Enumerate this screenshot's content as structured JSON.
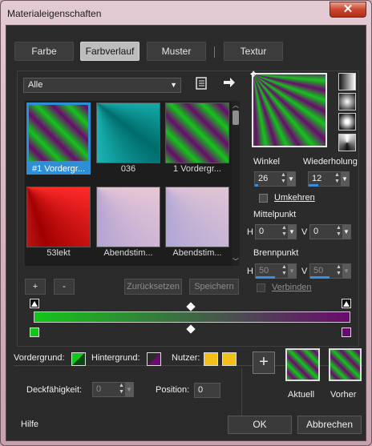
{
  "window": {
    "title": "Materialeigenschaften",
    "close_glyph": "✕"
  },
  "tabs": [
    {
      "label": "Farbe",
      "active": false
    },
    {
      "label": "Farbverlauf",
      "active": true
    },
    {
      "label": "Muster",
      "active": false
    },
    {
      "label": "Textur",
      "active": false
    }
  ],
  "library": {
    "category": "Alle",
    "items": [
      {
        "label": "#1 Vordergr...",
        "style": "fg",
        "selected": true
      },
      {
        "label": "036",
        "style": "cyan",
        "selected": false
      },
      {
        "label": "1 Vordergr...",
        "style": "fg2",
        "selected": false
      },
      {
        "label": "53lekt",
        "style": "red",
        "selected": false
      },
      {
        "label": "Abendstim...",
        "style": "dusk",
        "selected": false
      },
      {
        "label": "Abendstim...",
        "style": "dusk2",
        "selected": false
      }
    ],
    "add_label": "+",
    "remove_label": "-",
    "reset_label": "Zurücksetzen",
    "save_label": "Speichern"
  },
  "settings": {
    "angle_label": "Winkel",
    "angle_value": "26",
    "repeat_label": "Wiederholung",
    "repeat_value": "12",
    "invert_label": "Umkehren",
    "midpoint_label": "Mittelpunkt",
    "midpoint_h": "0",
    "midpoint_v": "0",
    "h_label": "H",
    "v_label": "V",
    "focal_label": "Brennpunkt",
    "focal_h": "50",
    "focal_v": "50",
    "link_label": "Verbinden"
  },
  "bottom": {
    "foreground_label": "Vordergrund:",
    "background_label": "Hintergrund:",
    "user_label": "Nutzer:",
    "opacity_label": "Deckfähigkeit:",
    "opacity_value": "0",
    "position_label": "Position:",
    "position_value": "0",
    "current_label": "Aktuell",
    "previous_label": "Vorher",
    "add_glyph": "+"
  },
  "footer": {
    "help_label": "Hilfe",
    "ok_label": "OK",
    "cancel_label": "Abbrechen"
  },
  "colors": {
    "green": "#13c51a",
    "purple": "#6a0a6e",
    "user_swatch": "#f3c01a",
    "accent": "#2e8fd7"
  },
  "icons": [
    "close-icon",
    "chevron-down-icon",
    "book-icon",
    "arrow-right-icon",
    "stop-marker-icon",
    "diamond-icon"
  ]
}
